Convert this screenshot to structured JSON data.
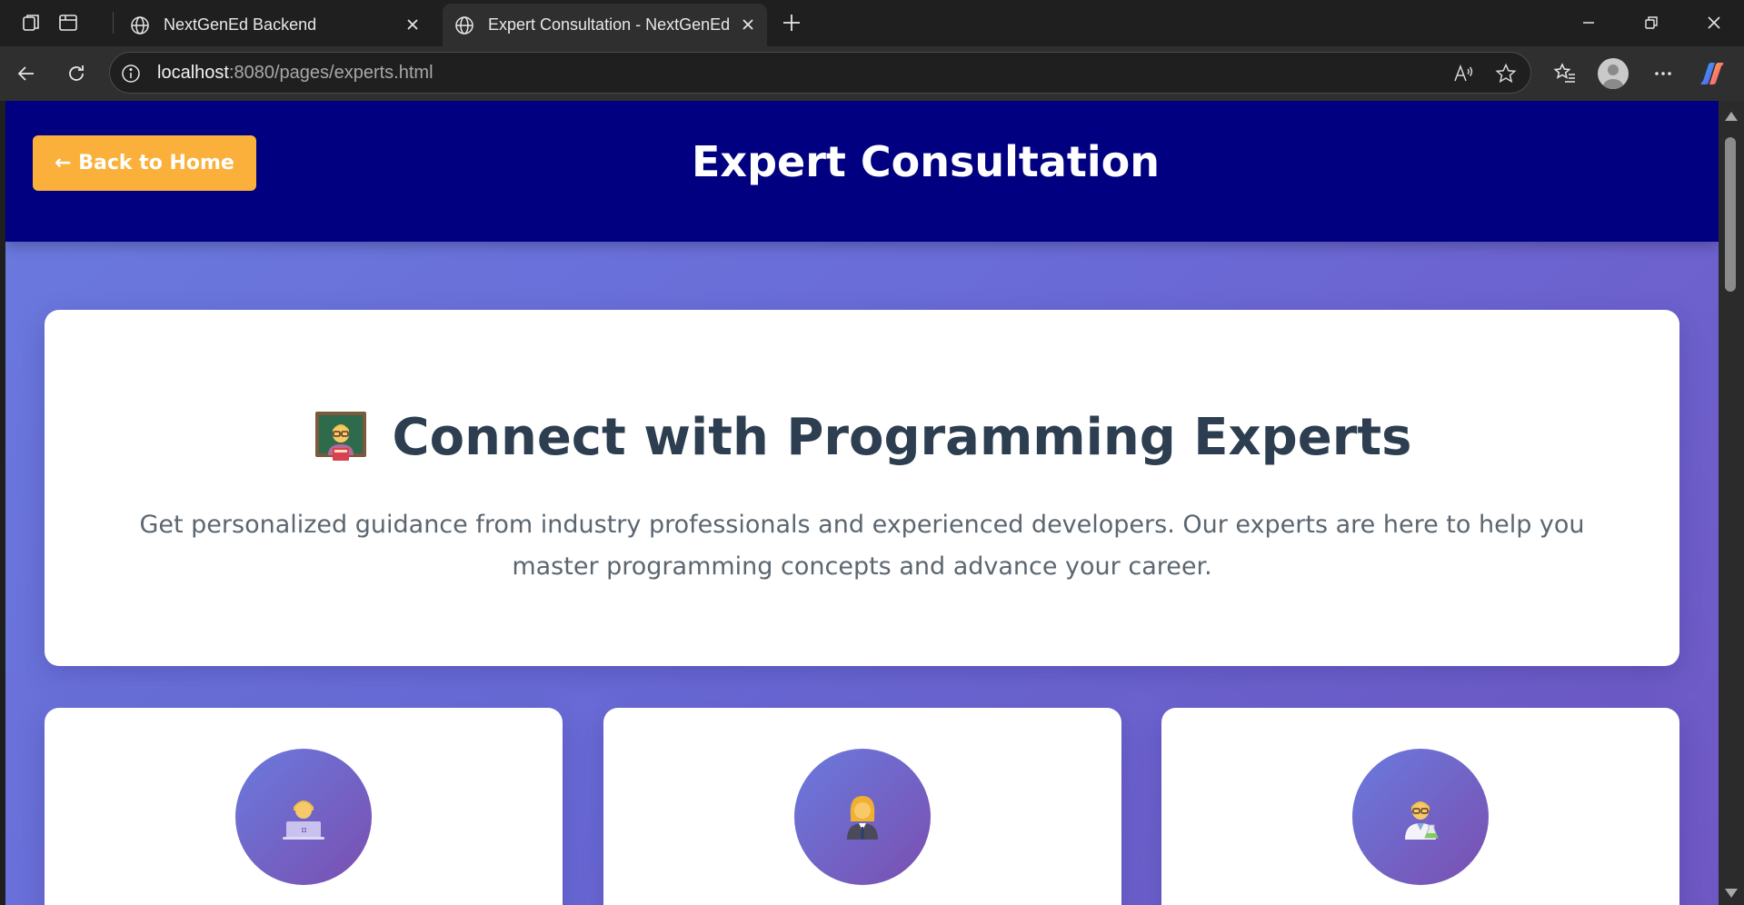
{
  "browser": {
    "tabs": [
      {
        "title": "NextGenEd Backend",
        "active": false
      },
      {
        "title": "Expert Consultation - NextGenEd",
        "active": true
      }
    ],
    "url_host": "localhost",
    "url_rest": ":8080/pages/experts.html"
  },
  "header": {
    "back_label": "← Back to Home",
    "title": "Expert Consultation"
  },
  "hero": {
    "title": "Connect with Programming Experts",
    "description": "Get personalized guidance from industry professionals and experienced developers. Our experts are here to help you master programming concepts and advance your career."
  },
  "experts": [
    {
      "avatar_icon": "developer-with-laptop-icon"
    },
    {
      "avatar_icon": "business-woman-icon"
    },
    {
      "avatar_icon": "scientist-icon"
    }
  ],
  "colors": {
    "header_bg": "#000080",
    "back_button": "#fbb03b",
    "hero_title": "#2c3e50",
    "page_gradient_start": "#6a7ade",
    "page_gradient_end": "#7058c4"
  }
}
